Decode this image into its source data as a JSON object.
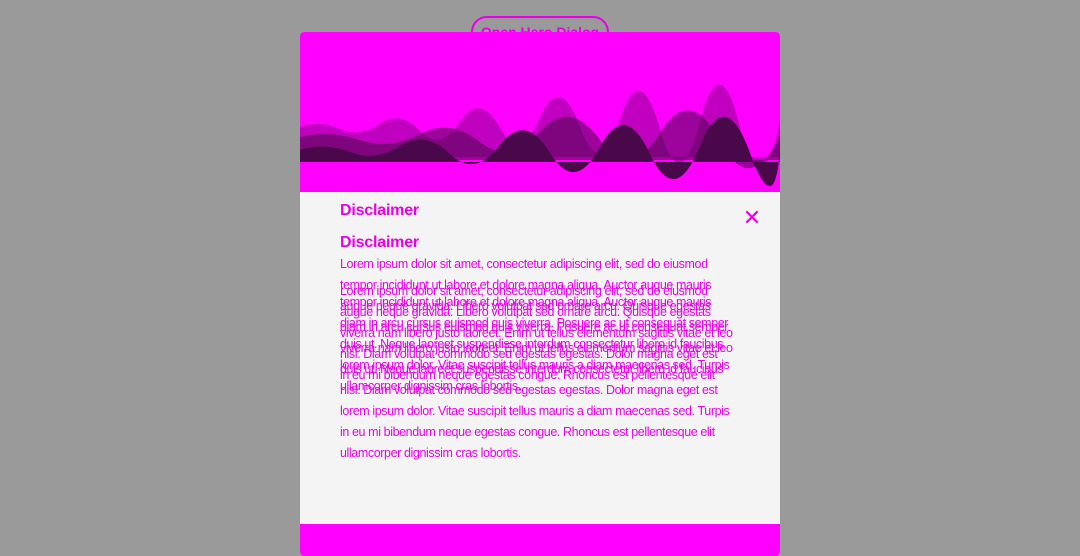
{
  "trigger": {
    "open_label": "Open Hero Dialog"
  },
  "dialog": {
    "title": "Disclaimer",
    "content_heading": "Disclaimer",
    "close_icon": "close-icon",
    "body": "Lorem ipsum dolor sit amet, consectetur adipiscing elit, sed do eiusmod tempor incididunt ut labore et dolore magna aliqua. Auctor augue mauris augue neque gravida. Libero volutpat sed ornare arcu. Quisque egestas diam in arcu cursus euismod quis viverra. Posuere ac ut consequat semper viverra nam libero justo laoreet. Enim ut tellus elementum sagittis vitae et leo duis ut. Neque laoreet suspendisse interdum consectetur libero id faucibus nisl. Diam volutpat commodo sed egestas egestas. Dolor magna eget est lorem ipsum dolor. Vitae suscipit tellus mauris a diam maecenas sed. Turpis in eu mi bibendum neque egestas congue. Rhoncus est pellentesque elit ullamcorper dignissim cras lobortis."
  },
  "colors": {
    "backdrop": "#9a9a9a",
    "accent": "#e800e8",
    "hero": "#ff00ff",
    "dialog_bg": "#f4f4f4"
  }
}
